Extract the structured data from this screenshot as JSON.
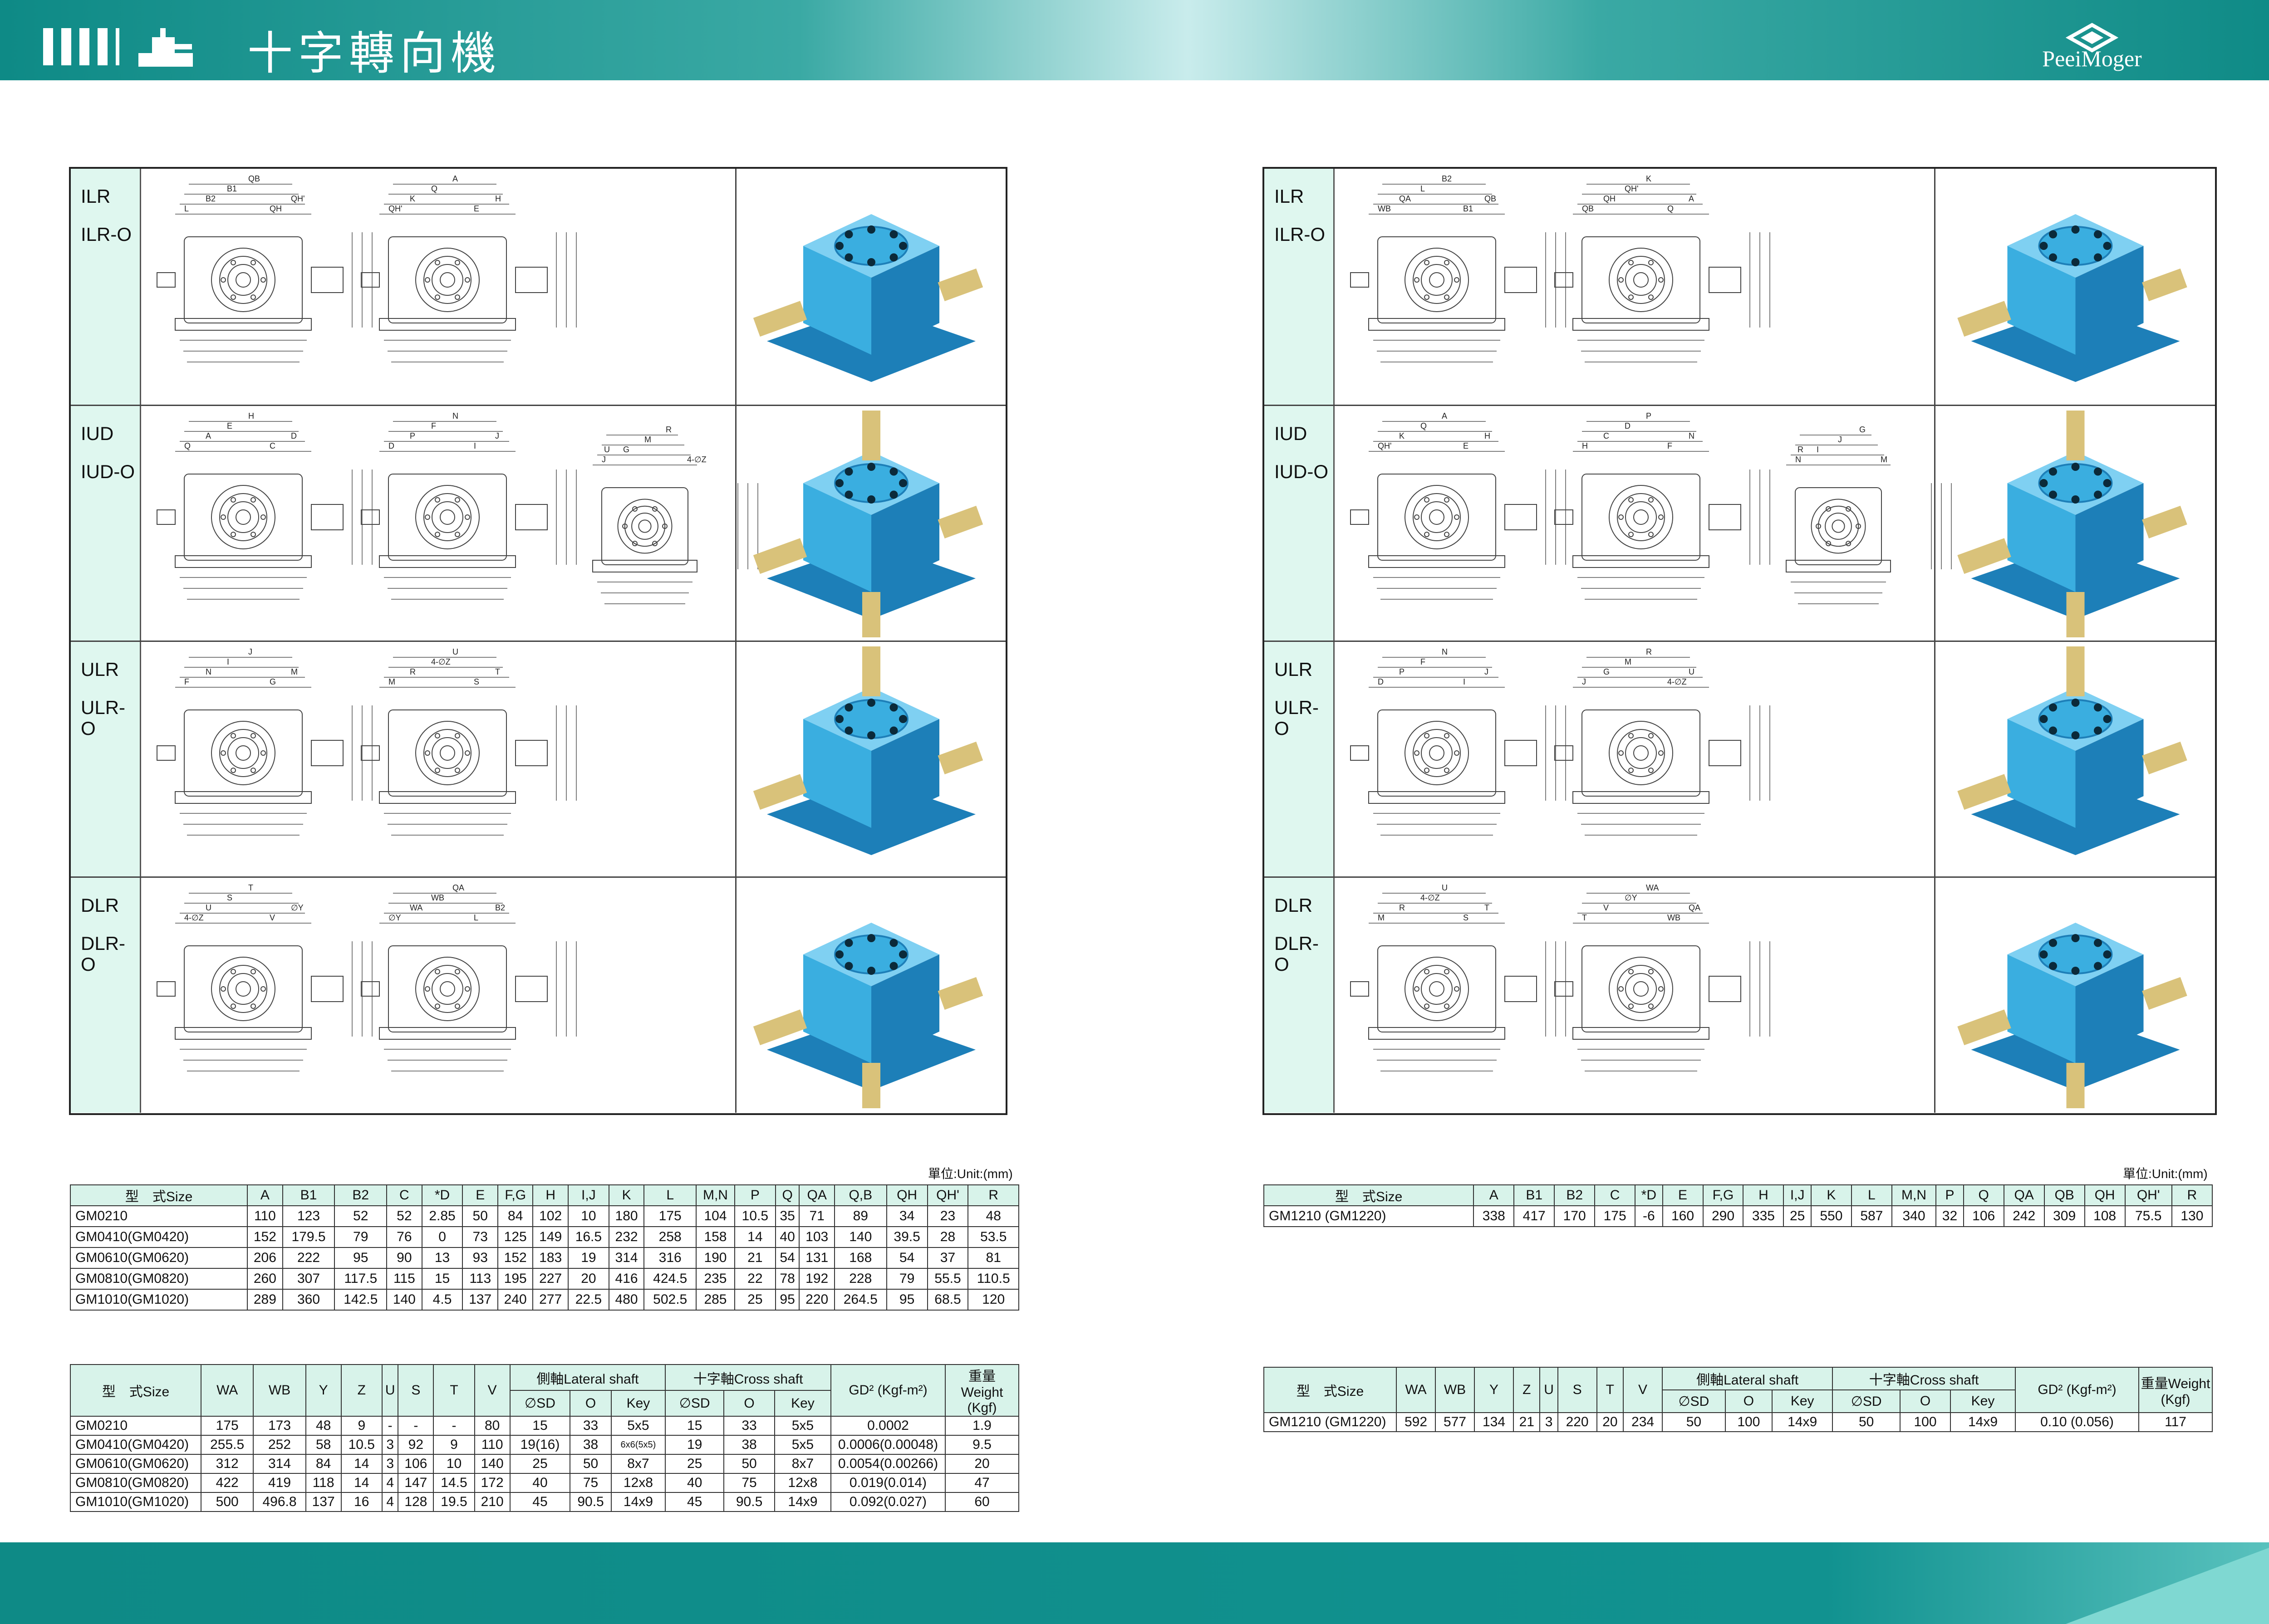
{
  "header": {
    "title": "十字轉向機",
    "brand": "PeeiMoger"
  },
  "panel_labels": [
    [
      "ILR",
      "ILR-O"
    ],
    [
      "IUD",
      "IUD-O"
    ],
    [
      "ULR",
      "ULR-O"
    ],
    [
      "DLR",
      "DLR-O"
    ]
  ],
  "unit_label": "單位:Unit:(mm)",
  "colors": {
    "teal": "#0e8a86",
    "header_cell": "#d8f3ea",
    "label_cell": "#dff7ef",
    "gearbox_blue": "#3aaee0"
  },
  "left_dim_table": {
    "header": [
      "型　式Size",
      "A",
      "B1",
      "B2",
      "C",
      "*D",
      "E",
      "F,G",
      "H",
      "I,J",
      "K",
      "L",
      "M,N",
      "P",
      "Q",
      "QA",
      "Q,B",
      "QH",
      "QH'",
      "R"
    ],
    "rows": [
      [
        "GM0210",
        "110",
        "123",
        "52",
        "52",
        "2.85",
        "50",
        "84",
        "102",
        "10",
        "180",
        "175",
        "104",
        "10.5",
        "35",
        "71",
        "89",
        "34",
        "23",
        "48"
      ],
      [
        "GM0410(GM0420)",
        "152",
        "179.5",
        "79",
        "76",
        "0",
        "73",
        "125",
        "149",
        "16.5",
        "232",
        "258",
        "158",
        "14",
        "40",
        "103",
        "140",
        "39.5",
        "28",
        "53.5"
      ],
      [
        "GM0610(GM0620)",
        "206",
        "222",
        "95",
        "90",
        "13",
        "93",
        "152",
        "183",
        "19",
        "314",
        "316",
        "190",
        "21",
        "54",
        "131",
        "168",
        "54",
        "37",
        "81"
      ],
      [
        "GM0810(GM0820)",
        "260",
        "307",
        "117.5",
        "115",
        "15",
        "113",
        "195",
        "227",
        "20",
        "416",
        "424.5",
        "235",
        "22",
        "78",
        "192",
        "228",
        "79",
        "55.5",
        "110.5"
      ],
      [
        "GM1010(GM1020)",
        "289",
        "360",
        "142.5",
        "140",
        "4.5",
        "137",
        "240",
        "277",
        "22.5",
        "480",
        "502.5",
        "285",
        "25",
        "95",
        "220",
        "264.5",
        "95",
        "68.5",
        "120"
      ]
    ]
  },
  "right_dim_table": {
    "header": [
      "型　式Size",
      "A",
      "B1",
      "B2",
      "C",
      "*D",
      "E",
      "F,G",
      "H",
      "I,J",
      "K",
      "L",
      "M,N",
      "P",
      "Q",
      "QA",
      "QB",
      "QH",
      "QH'",
      "R"
    ],
    "rows": [
      [
        "GM1210 (GM1220)",
        "338",
        "417",
        "170",
        "175",
        "-6",
        "160",
        "290",
        "335",
        "25",
        "550",
        "587",
        "340",
        "32",
        "106",
        "242",
        "309",
        "108",
        "75.5",
        "130"
      ]
    ]
  },
  "shaft_table_labels": {
    "size": "型　式Size",
    "cols": [
      "WA",
      "WB",
      "Y",
      "Z",
      "U",
      "S",
      "T",
      "V"
    ],
    "lateral": "側軸Lateral shaft",
    "cross": "十字軸Cross shaft",
    "sub": [
      "∅SD",
      "O",
      "Key"
    ],
    "gd2": "GD² (Kgf-m²)",
    "weight": "重量 Weight (Kgf)",
    "weight_r": "重量Weight (Kgf)"
  },
  "left_shaft_table": {
    "rows": [
      [
        "GM0210",
        "175",
        "173",
        "48",
        "9",
        "-",
        "-",
        "-",
        "80",
        "15",
        "33",
        "5x5",
        "15",
        "33",
        "5x5",
        "0.0002",
        "1.9"
      ],
      [
        "GM0410(GM0420)",
        "255.5",
        "252",
        "58",
        "10.5",
        "3",
        "92",
        "9",
        "110",
        "19(16)",
        "38",
        "6x6(5x5)",
        "19",
        "38",
        "5x5",
        "0.0006(0.00048)",
        "9.5"
      ],
      [
        "GM0610(GM0620)",
        "312",
        "314",
        "84",
        "14",
        "3",
        "106",
        "10",
        "140",
        "25",
        "50",
        "8x7",
        "25",
        "50",
        "8x7",
        "0.0054(0.00266)",
        "20"
      ],
      [
        "GM0810(GM0820)",
        "422",
        "419",
        "118",
        "14",
        "4",
        "147",
        "14.5",
        "172",
        "40",
        "75",
        "12x8",
        "40",
        "75",
        "12x8",
        "0.019(0.014)",
        "47"
      ],
      [
        "GM1010(GM1020)",
        "500",
        "496.8",
        "137",
        "16",
        "4",
        "128",
        "19.5",
        "210",
        "45",
        "90.5",
        "14x9",
        "45",
        "90.5",
        "14x9",
        "0.092(0.027)",
        "60"
      ]
    ]
  },
  "right_shaft_table": {
    "rows": [
      [
        "GM1210 (GM1220)",
        "592",
        "577",
        "134",
        "21",
        "3",
        "220",
        "20",
        "234",
        "50",
        "100",
        "14x9",
        "50",
        "100",
        "14x9",
        "0.10  (0.056)",
        "117"
      ]
    ]
  },
  "dimension_letters": [
    "L",
    "B2",
    "B1",
    "QB",
    "QH",
    "QH'",
    "K",
    "Q",
    "A",
    "E",
    "H",
    "C",
    "D",
    "P",
    "F",
    "N",
    "I",
    "J",
    "G",
    "M",
    "R",
    "4-∅Z",
    "U",
    "S",
    "T",
    "V",
    "∅Y",
    "WA",
    "WB",
    "QA"
  ]
}
